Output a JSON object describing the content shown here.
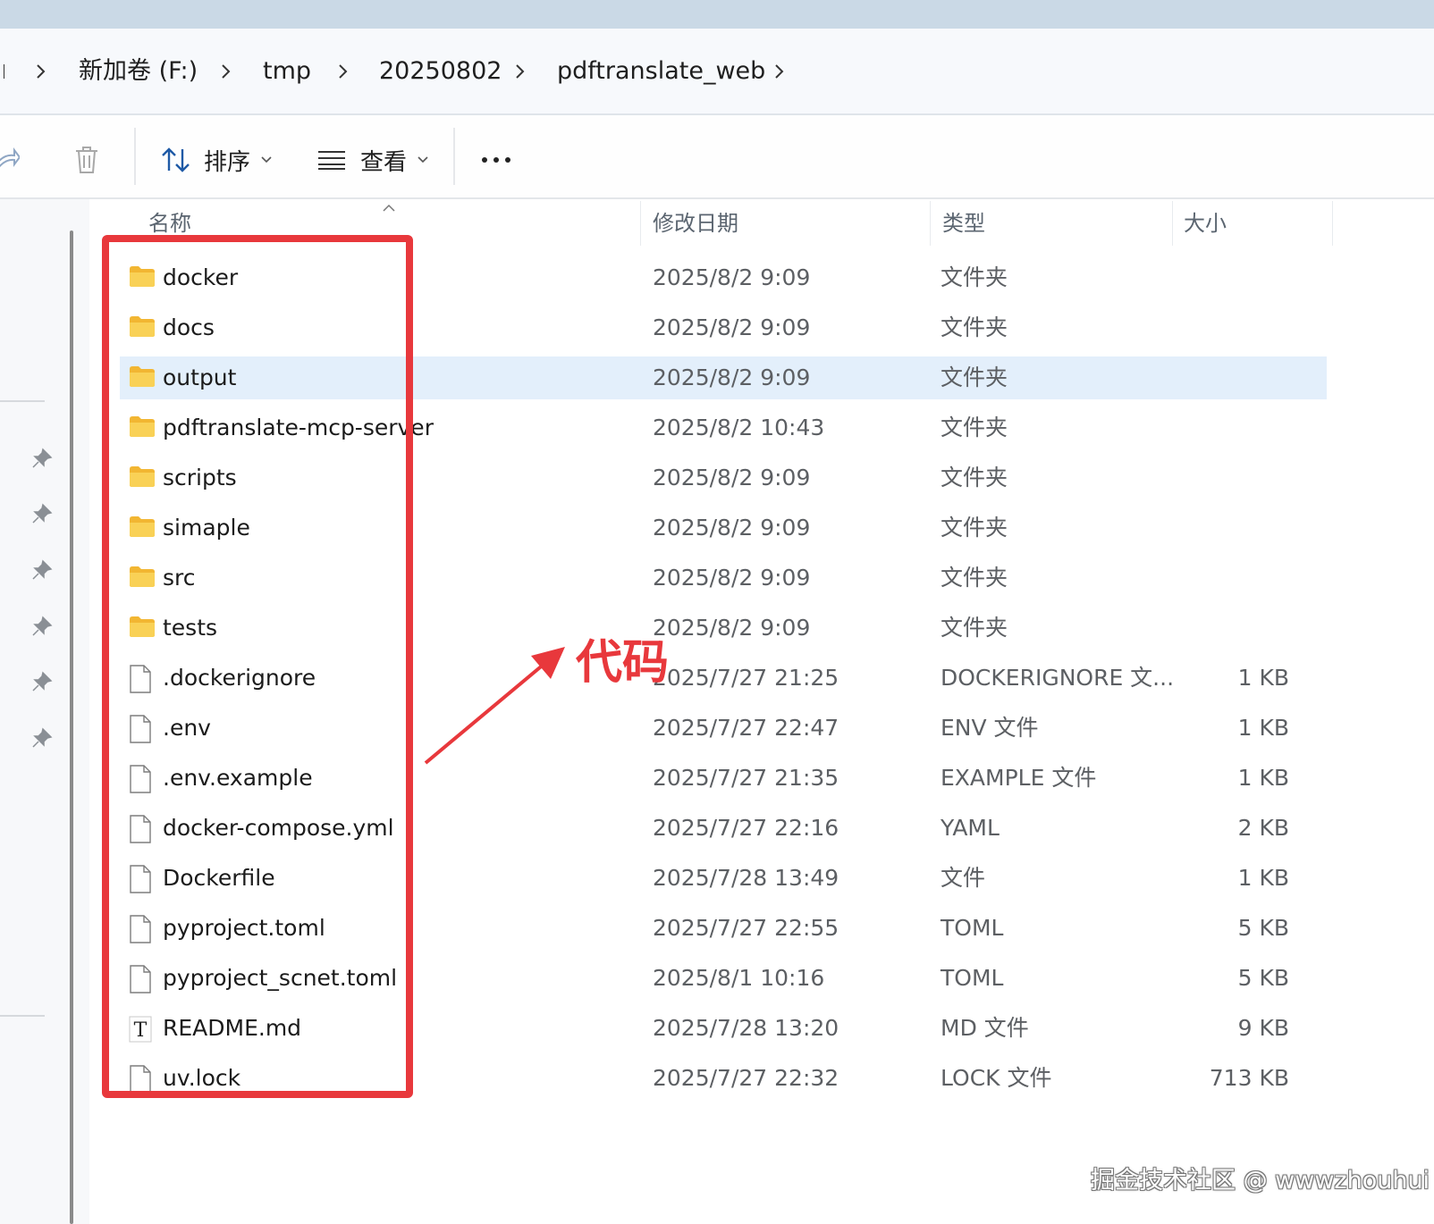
{
  "breadcrumb": {
    "items": [
      "新加卷 (F:)",
      "tmp",
      "20250802",
      "pdftranslate_web"
    ]
  },
  "toolbar": {
    "sort_label": "排序",
    "view_label": "查看"
  },
  "columns": {
    "name": "名称",
    "date": "修改日期",
    "type": "类型",
    "size": "大小"
  },
  "files": [
    {
      "name": "docker",
      "date": "2025/8/2 9:09",
      "type": "文件夹",
      "size": "",
      "icon": "folder-icon"
    },
    {
      "name": "docs",
      "date": "2025/8/2 9:09",
      "type": "文件夹",
      "size": "",
      "icon": "folder-icon"
    },
    {
      "name": "output",
      "date": "2025/8/2 9:09",
      "type": "文件夹",
      "size": "",
      "icon": "folder-icon"
    },
    {
      "name": "pdftranslate-mcp-server",
      "date": "2025/8/2 10:43",
      "type": "文件夹",
      "size": "",
      "icon": "folder-icon"
    },
    {
      "name": "scripts",
      "date": "2025/8/2 9:09",
      "type": "文件夹",
      "size": "",
      "icon": "folder-icon"
    },
    {
      "name": "simaple",
      "date": "2025/8/2 9:09",
      "type": "文件夹",
      "size": "",
      "icon": "folder-icon"
    },
    {
      "name": "src",
      "date": "2025/8/2 9:09",
      "type": "文件夹",
      "size": "",
      "icon": "folder-icon"
    },
    {
      "name": "tests",
      "date": "2025/8/2 9:09",
      "type": "文件夹",
      "size": "",
      "icon": "folder-icon"
    },
    {
      "name": ".dockerignore",
      "date": "2025/7/27 21:25",
      "type": "DOCKERIGNORE 文...",
      "size": "1 KB",
      "icon": "file-icon"
    },
    {
      "name": ".env",
      "date": "2025/7/27 22:47",
      "type": "ENV 文件",
      "size": "1 KB",
      "icon": "file-icon"
    },
    {
      "name": ".env.example",
      "date": "2025/7/27 21:35",
      "type": "EXAMPLE 文件",
      "size": "1 KB",
      "icon": "file-icon"
    },
    {
      "name": "docker-compose.yml",
      "date": "2025/7/27 22:16",
      "type": "YAML",
      "size": "2 KB",
      "icon": "file-icon"
    },
    {
      "name": "Dockerfile",
      "date": "2025/7/28 13:49",
      "type": "文件",
      "size": "1 KB",
      "icon": "file-icon"
    },
    {
      "name": "pyproject.toml",
      "date": "2025/7/27 22:55",
      "type": "TOML",
      "size": "5 KB",
      "icon": "file-icon"
    },
    {
      "name": "pyproject_scnet.toml",
      "date": "2025/8/1 10:16",
      "type": "TOML",
      "size": "5 KB",
      "icon": "file-icon"
    },
    {
      "name": "README.md",
      "date": "2025/7/28 13:20",
      "type": "MD 文件",
      "size": "9 KB",
      "icon": "text-file-icon"
    },
    {
      "name": "uv.lock",
      "date": "2025/7/27 22:32",
      "type": "LOCK 文件",
      "size": "713 KB",
      "icon": "file-icon"
    }
  ],
  "selected_file": "output",
  "annotation": {
    "label": "代码",
    "color": "#e8383c"
  },
  "watermark": "掘金技术社区 @ wwwzhouhui",
  "colors": {
    "selected_row": "#e3effb",
    "folder": "#f7c948",
    "title_strip": "#cad9e6"
  }
}
